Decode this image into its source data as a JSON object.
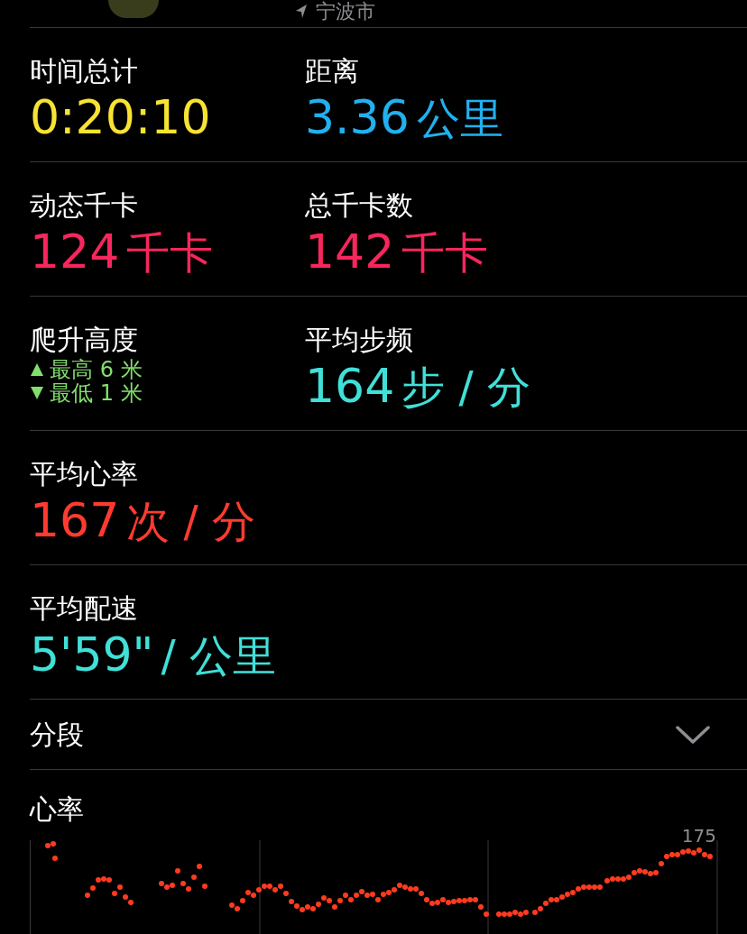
{
  "header": {
    "location": "宁波市"
  },
  "metric_rows": [
    {
      "cells": [
        {
          "kind": "value",
          "label": "时间总计",
          "value": "0:20:10",
          "color": "#f7e332"
        },
        {
          "kind": "value",
          "label": "距离",
          "value": "3.36",
          "unit": "公里",
          "color": "#22b0ee"
        }
      ]
    },
    {
      "cells": [
        {
          "kind": "value",
          "label": "动态千卡",
          "value": "124",
          "unit": "千卡",
          "color": "#f7265c"
        },
        {
          "kind": "value",
          "label": "总千卡数",
          "value": "142",
          "unit": "千卡",
          "color": "#f7265c"
        }
      ]
    },
    {
      "cells": [
        {
          "kind": "elevation",
          "label": "爬升高度",
          "high": "最高 6 米",
          "low": "最低 1 米",
          "color": "#82df6c"
        },
        {
          "kind": "value",
          "label": "平均步频",
          "value": "164",
          "unit": "步 / 分",
          "color": "#40e0d8"
        }
      ]
    },
    {
      "cells": [
        {
          "kind": "value",
          "label": "平均心率",
          "value": "167",
          "unit": "次 / 分",
          "color": "#ff3b30"
        }
      ]
    },
    {
      "cells": [
        {
          "kind": "value",
          "label": "平均配速",
          "value": "5'59\"",
          "unit": "/ 公里",
          "color": "#40e0d8"
        }
      ]
    }
  ],
  "splits": {
    "label": "分段",
    "expanded": false
  },
  "heart_rate": {
    "title": "心率",
    "max_label": "175"
  }
}
